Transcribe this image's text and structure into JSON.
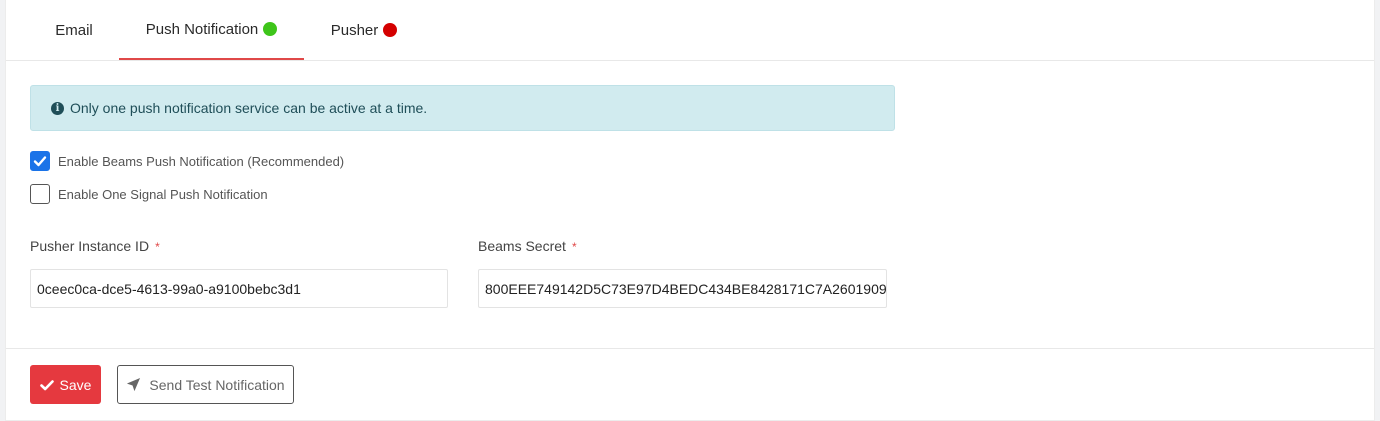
{
  "tabs": [
    {
      "label": "Email",
      "status_color": ""
    },
    {
      "label": "Push Notification",
      "status_color": "#3ec51a"
    },
    {
      "label": "Pusher",
      "status_color": "#d40000"
    }
  ],
  "active_tab": "Push Notification",
  "alert": {
    "icon": "info-circle-icon",
    "text": "Only one push notification service can be active at a time."
  },
  "options": [
    {
      "label": "Enable Beams Push Notification (Recommended)",
      "checked": true
    },
    {
      "label": "Enable One Signal Push Notification",
      "checked": false
    }
  ],
  "fields": {
    "instance_id": {
      "label": "Pusher Instance ID",
      "required_mark": "*",
      "value": "0ceec0ca-dce5-4613-99a0-a9100bebc3d1"
    },
    "beams_secret": {
      "label": "Beams Secret",
      "required_mark": "*",
      "value": "800EEE749142D5C73E97D4BEDC434BE8428171C7A2601909"
    }
  },
  "buttons": {
    "save": {
      "label": "Save",
      "icon": "check-icon"
    },
    "send_test": {
      "label": "Send Test Notification",
      "icon": "paper-plane-icon"
    }
  },
  "colors": {
    "accent": "#e5393f",
    "checkbox": "#1a73e8",
    "alert_bg": "#d1ebef"
  }
}
